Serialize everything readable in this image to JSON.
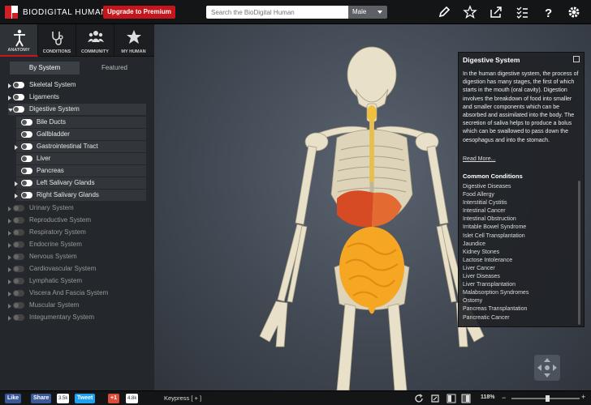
{
  "app": {
    "brand": "BIODIGITAL HUMAN",
    "upgrade_label": "Upgrade to Premium"
  },
  "search": {
    "placeholder": "Search the BioDigital Human"
  },
  "gender_select": {
    "value": "Male"
  },
  "nav_tabs": [
    {
      "label": "ANATOMY",
      "icon": "body-icon",
      "active": true
    },
    {
      "label": "CONDITIONS",
      "icon": "stethoscope-icon"
    },
    {
      "label": "COMMUNITY",
      "icon": "people-icon"
    },
    {
      "label": "MY HUMAN",
      "icon": "star-icon"
    }
  ],
  "sub_tabs": {
    "by_system": "By System",
    "featured": "Featured"
  },
  "tree": {
    "skeletal": "Skeletal System",
    "ligaments": "Ligaments",
    "digestive": "Digestive System",
    "bile_ducts": "Bile Ducts",
    "gallbladder": "Gallbladder",
    "gi_tract": "Gastrointestinal Tract",
    "liver": "Liver",
    "pancreas": "Pancreas",
    "left_salivary": "Left Salivary Glands",
    "right_salivary": "Right Salivary Glands",
    "urinary": "Urinary System",
    "reproductive": "Reproductive System",
    "respiratory": "Respiratory System",
    "endocrine": "Endocrine System",
    "nervous": "Nervous System",
    "cardiovascular": "Cardiovascular System",
    "lymphatic": "Lymphatic System",
    "viscera": "Viscera And Fascia System",
    "muscular": "Muscular System",
    "integumentary": "Integumentary System"
  },
  "info_panel": {
    "title": "Digestive System",
    "description": "In the human digestive system, the process of digestion has many stages, the first of which starts in the mouth (oral cavity). Digestion involves the breakdown of food into smaller and smaller components which can be absorbed and assimilated into the body. The secretion of saliva helps to produce a bolus which can be swallowed to pass down the oesophagus and into the stomach.",
    "read_more": "Read More...",
    "conditions_heading": "Common Conditions",
    "conditions": [
      "Digestive Diseases",
      "Food Allergy",
      "Interstitial Cystitis",
      "Intestinal Cancer",
      "Intestinal Obstruction",
      "Irritable Bowel Syndrome",
      "Islet Cell Transplantation",
      "Jaundice",
      "Kidney Stones",
      "Lactose Intolerance",
      "Liver Cancer",
      "Liver Diseases",
      "Liver Transplantation",
      "Malabsorption Syndromes",
      "Ostomy",
      "Pancreas Transplantation",
      "Pancreatic Cancer"
    ]
  },
  "social": {
    "like": "Like",
    "share": "Share",
    "share_count": "3.5k",
    "tweet": "Tweet",
    "gplus": "+1",
    "gplus_count": "4.8k"
  },
  "bottom": {
    "keypress": "Keypress [ + ]",
    "zoom": "118%"
  },
  "colors": {
    "accent": "#c4161c",
    "facebook": "#3b5998",
    "twitter": "#1da1f2",
    "gplus": "#dd4b39"
  }
}
